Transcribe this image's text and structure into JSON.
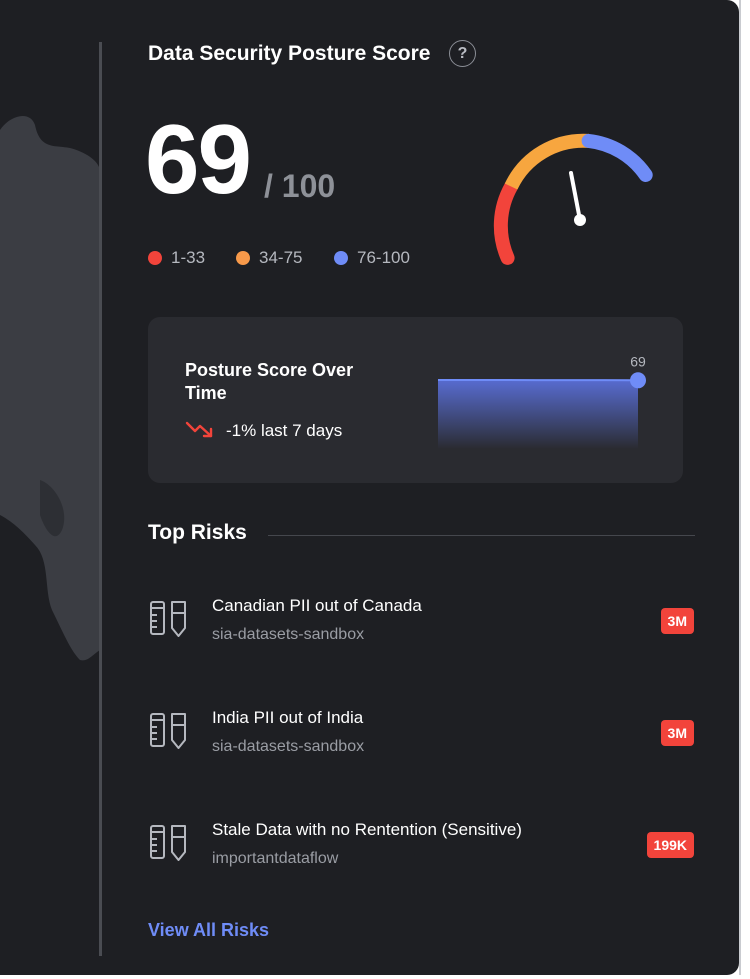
{
  "posture": {
    "title": "Data Security Posture Score",
    "help_icon": "question-circle-icon",
    "help_glyph": "?",
    "score": "69",
    "score_max": "/ 100",
    "legend": [
      {
        "label": "1-33",
        "color": "#f2443b"
      },
      {
        "label": "34-75",
        "color": "#f7994a"
      },
      {
        "label": "76-100",
        "color": "#6f8cf7"
      }
    ],
    "gauge": {
      "value": 69,
      "min": 0,
      "max": 100
    }
  },
  "trend_card": {
    "title": "Posture Score Over Time",
    "trend_icon": "trending-down-icon",
    "change_text": "-1% last 7 days",
    "sparkline": {
      "values": [
        70,
        70,
        70,
        69.6,
        69.5,
        69.7,
        69
      ],
      "last_label": "69"
    }
  },
  "top_risks": {
    "title": "Top Risks",
    "items": [
      {
        "icon": "test-tubes-icon",
        "name": "Canadian PII out of Canada",
        "source": "sia-datasets-sandbox",
        "count": "3M"
      },
      {
        "icon": "test-tubes-icon",
        "name": "India PII out of India",
        "source": "sia-datasets-sandbox",
        "count": "3M"
      },
      {
        "icon": "test-tubes-icon",
        "name": "Stale Data with no Rentention (Sensitive)",
        "source": "importantdataflow",
        "count": "199K"
      }
    ],
    "view_all_label": "View All Risks"
  },
  "colors": {
    "panel_bg": "#1e1f23",
    "card_bg": "#2a2b30",
    "accent_blue": "#6f8cf7",
    "danger": "#f2443b",
    "warning": "#f7994a"
  }
}
